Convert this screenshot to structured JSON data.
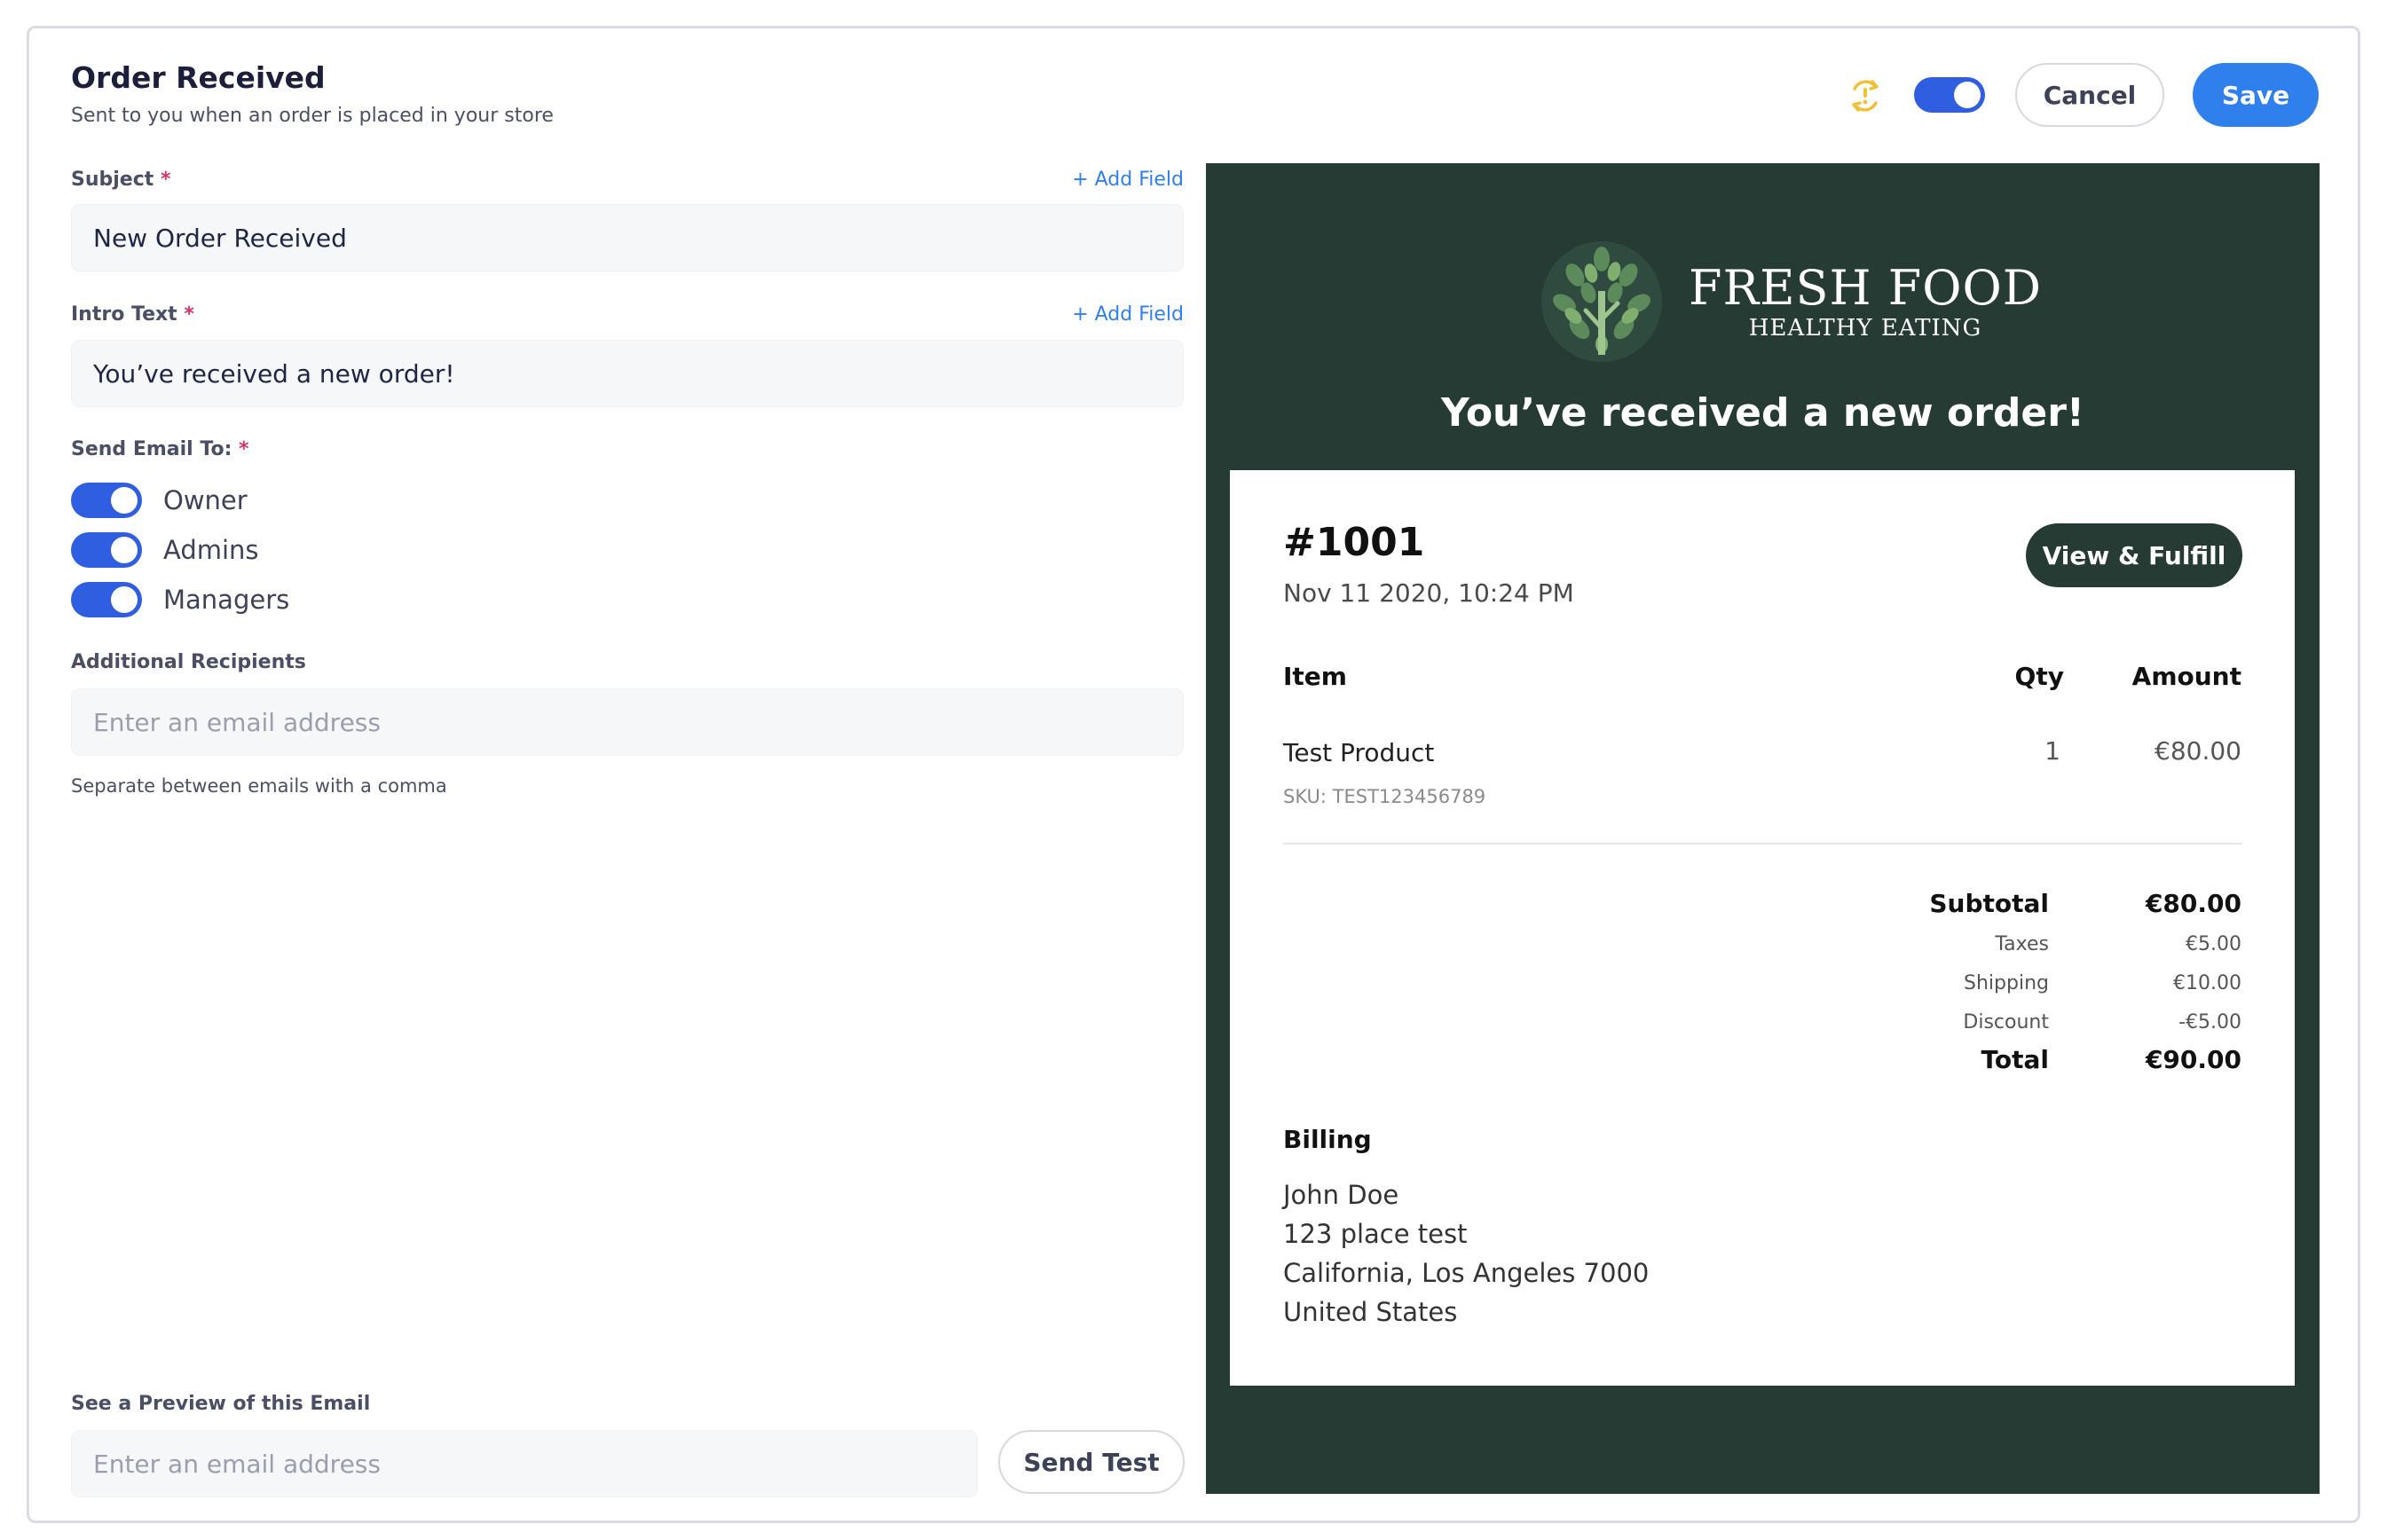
{
  "header": {
    "title": "Order Received",
    "subtitle": "Sent to you when an order is placed in your store",
    "cancel_label": "Cancel",
    "save_label": "Save",
    "enabled": true
  },
  "form": {
    "subject": {
      "label": "Subject",
      "required_mark": "*",
      "add_field": "+ Add Field",
      "value": "New Order Received"
    },
    "intro": {
      "label": "Intro Text",
      "required_mark": "*",
      "add_field": "+ Add Field",
      "value": "You’ve received a new order!"
    },
    "send_to": {
      "label": "Send Email To:",
      "required_mark": "*",
      "recipients": [
        {
          "label": "Owner",
          "enabled": true
        },
        {
          "label": "Admins",
          "enabled": true
        },
        {
          "label": "Managers",
          "enabled": true
        }
      ]
    },
    "additional": {
      "label": "Additional Recipients",
      "placeholder": "Enter an email address",
      "help": "Separate between emails with a comma"
    },
    "preview": {
      "label": "See a Preview of this Email",
      "placeholder": "Enter an email address",
      "send_test_label": "Send Test"
    }
  },
  "email_preview": {
    "brand_name": "FRESH FOOD",
    "brand_tagline": "HEALTHY EATING",
    "headline": "You’ve received a new order!",
    "order_number": "#1001",
    "order_date": "Nov 11 2020, 10:24 PM",
    "fulfill_label": "View & Fulfill",
    "columns": {
      "item": "Item",
      "qty": "Qty",
      "amount": "Amount"
    },
    "items": [
      {
        "name": "Test Product",
        "sku": "SKU: TEST123456789",
        "qty": "1",
        "amount": "€80.00"
      }
    ],
    "summary": {
      "subtotal_label": "Subtotal",
      "subtotal": "€80.00",
      "taxes_label": "Taxes",
      "taxes": "€5.00",
      "shipping_label": "Shipping",
      "shipping": "€10.00",
      "discount_label": "Discount",
      "discount": "-€5.00",
      "total_label": "Total",
      "total": "€90.00"
    },
    "billing": {
      "title": "Billing",
      "lines": [
        "John Doe",
        "123 place test",
        "California, Los Angeles 7000",
        "United States"
      ]
    }
  },
  "colors": {
    "primary": "#2f80ed",
    "toggle": "#2f5ee0",
    "preview_bg": "#253b33",
    "required": "#d6336c",
    "sync_icon": "#f2c037"
  },
  "icons": {
    "sync": "sync-alert-icon",
    "logo": "leaf-tree-logo"
  }
}
